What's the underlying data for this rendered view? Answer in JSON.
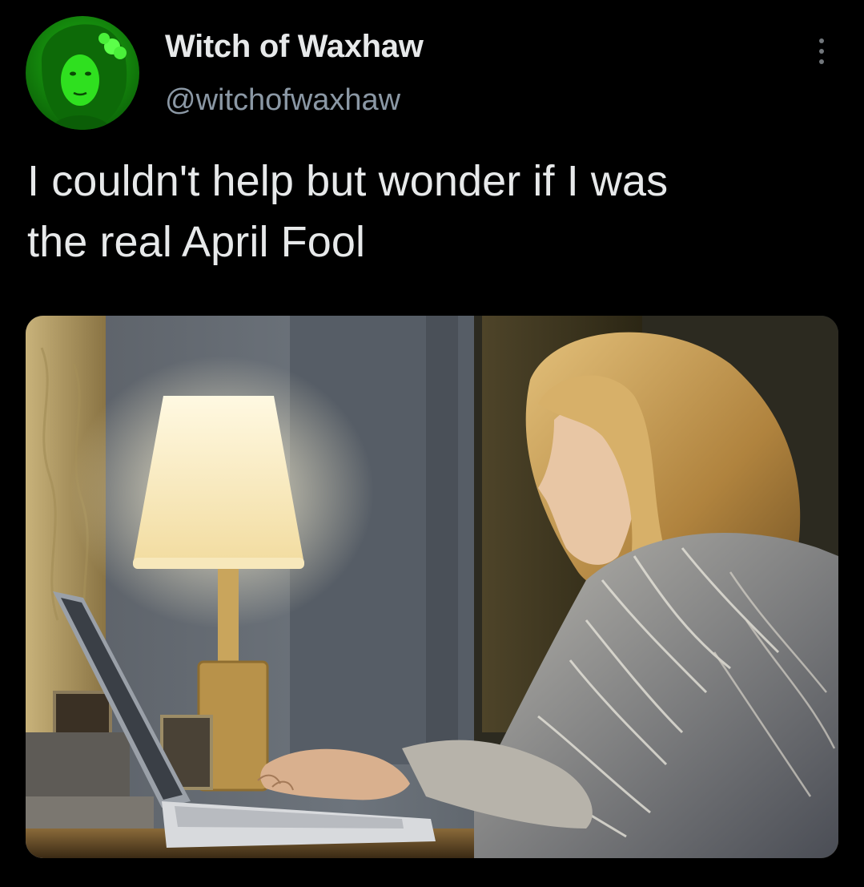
{
  "tweet": {
    "display_name": "Witch of Waxhaw",
    "handle": "@witchofwaxhaw",
    "text_line1": "I couldn't help but wonder if I was",
    "text_line2": "the real April Fool"
  },
  "icons": {
    "more": "more-vertical-icon"
  },
  "colors": {
    "background": "#000000",
    "text_primary": "#e7e9ea",
    "text_secondary": "#8b98a5",
    "avatar_tint": "#22e01a"
  }
}
